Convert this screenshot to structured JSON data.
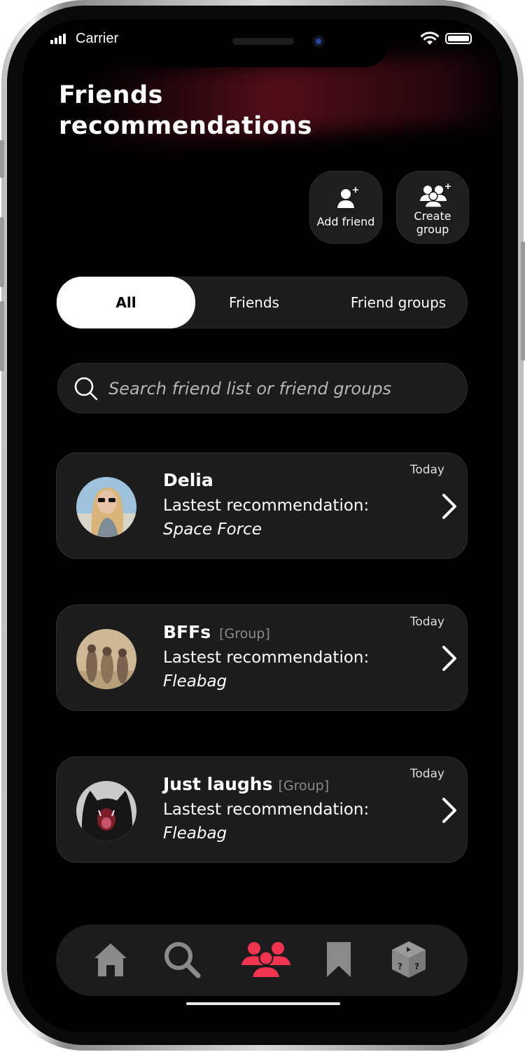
{
  "status": {
    "carrier": "Carrier"
  },
  "header": {
    "title_line1": "Friends",
    "title_line2": "recommendations"
  },
  "actions": {
    "add_friend": "Add friend",
    "create_group_line1": "Create",
    "create_group_line2": "group"
  },
  "tabs": [
    {
      "label": "All",
      "active": true
    },
    {
      "label": "Friends",
      "active": false
    },
    {
      "label": "Friend groups",
      "active": false
    }
  ],
  "search": {
    "placeholder": "Search friend list or friend groups"
  },
  "recommendations": [
    {
      "name": "Delia",
      "tag": "",
      "label": "Lastest recommendation:",
      "show": "Space Force",
      "date": "Today",
      "avatar": "woman-sunglasses-photo"
    },
    {
      "name": "BFFs",
      "tag": "[Group]",
      "label": "Lastest recommendation:",
      "show": "Fleabag",
      "date": "Today",
      "avatar": "meerkats-photo"
    },
    {
      "name": "Just laughs",
      "tag": "[Group]",
      "label": "Lastest recommendation:",
      "show": "Fleabag",
      "date": "Today",
      "avatar": "black-cat-yawning-photo"
    }
  ],
  "nav": {
    "items": [
      "home-icon",
      "search-icon",
      "friends-icon",
      "bookmark-icon",
      "random-dice-icon"
    ],
    "active": "friends-icon"
  },
  "colors": {
    "accent": "#f0344f",
    "background": "#000000",
    "card": "#1c1c1c",
    "nav_inactive": "#8a8a8a"
  }
}
